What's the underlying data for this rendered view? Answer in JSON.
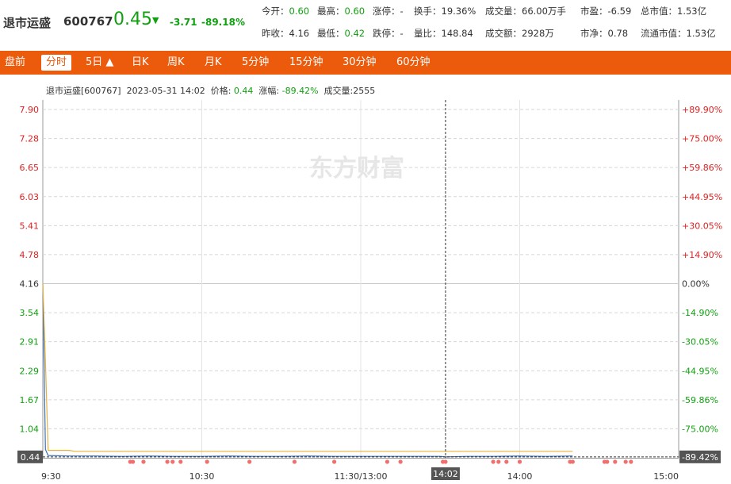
{
  "header": {
    "name": "退市运盛",
    "code": "600767",
    "price": "0.45",
    "arrow": "▼",
    "change": "-3.71",
    "change_pct": "-89.18%"
  },
  "quotes": [
    {
      "label": "今开：",
      "value": "0.60",
      "tone": "down"
    },
    {
      "label": "最高：",
      "value": "0.60",
      "tone": "down"
    },
    {
      "label": "涨停：",
      "value": "-",
      "tone": ""
    },
    {
      "label": "换手：",
      "value": "19.36%",
      "tone": ""
    },
    {
      "label": "成交量：",
      "value": "66.00万手",
      "tone": ""
    },
    {
      "label": "市盈：",
      "value": "-6.59",
      "tone": ""
    },
    {
      "label": "总市值：",
      "value": "1.53亿",
      "tone": ""
    },
    {
      "label": "昨收：",
      "value": "4.16",
      "tone": ""
    },
    {
      "label": "最低：",
      "value": "0.42",
      "tone": "down"
    },
    {
      "label": "跌停：",
      "value": "-",
      "tone": ""
    },
    {
      "label": "量比：",
      "value": "148.84",
      "tone": ""
    },
    {
      "label": "成交额：",
      "value": "2928万",
      "tone": ""
    },
    {
      "label": "市净：",
      "value": "0.78",
      "tone": ""
    },
    {
      "label": "流通市值：",
      "value": "1.53亿",
      "tone": ""
    }
  ],
  "tabs": [
    {
      "label": "盘前",
      "active": false
    },
    {
      "label": "分时",
      "active": true
    },
    {
      "label": "5日 ▲",
      "active": false
    },
    {
      "label": "日K",
      "active": false
    },
    {
      "label": "周K",
      "active": false
    },
    {
      "label": "月K",
      "active": false
    },
    {
      "label": "5分钟",
      "active": false
    },
    {
      "label": "15分钟",
      "active": false
    },
    {
      "label": "30分钟",
      "active": false
    },
    {
      "label": "60分钟",
      "active": false
    }
  ],
  "info": {
    "name_code": "退市运盛[600767]",
    "datetime": "2023-05-31 14:02",
    "price_label": "价格:",
    "price_value": "0.44",
    "change_label": "涨幅:",
    "change_value": "-89.42%",
    "volume_label": "成交量:",
    "volume_value": "2555"
  },
  "watermark": "东方财富",
  "chart_data": {
    "type": "line",
    "y_ticks_left": [
      "7.90",
      "7.28",
      "6.65",
      "6.03",
      "5.41",
      "4.78",
      "4.16",
      "3.54",
      "2.91",
      "2.29",
      "1.67",
      "1.04"
    ],
    "y_ticks_right": [
      "+89.90%",
      "+75.00%",
      "+59.86%",
      "+44.95%",
      "+30.05%",
      "+14.90%",
      "0.00%",
      "-14.90%",
      "-30.05%",
      "-44.95%",
      "-59.86%",
      "-75.00%"
    ],
    "ylim": [
      0.42,
      7.9
    ],
    "prev_close": 4.16,
    "x_ticks": [
      "9:30",
      "10:30",
      "11:30/13:00",
      "14:00",
      "15:00"
    ],
    "crosshair": {
      "time": "14:02",
      "price_label": "0.44",
      "pct_label": "-89.42%",
      "minute": 152
    },
    "total_minutes": 240,
    "series": [
      {
        "role": "price",
        "color": "#3b6fb5",
        "points": [
          [
            0,
            4.16
          ],
          [
            1,
            0.6
          ],
          [
            2,
            0.47
          ],
          [
            10,
            0.46
          ],
          [
            20,
            0.46
          ],
          [
            30,
            0.45
          ],
          [
            40,
            0.46
          ],
          [
            50,
            0.45
          ],
          [
            60,
            0.45
          ],
          [
            70,
            0.46
          ],
          [
            80,
            0.45
          ],
          [
            90,
            0.45
          ],
          [
            100,
            0.46
          ],
          [
            110,
            0.45
          ],
          [
            120,
            0.45
          ],
          [
            130,
            0.45
          ],
          [
            140,
            0.45
          ],
          [
            150,
            0.45
          ],
          [
            152,
            0.44
          ],
          [
            160,
            0.45
          ],
          [
            170,
            0.45
          ],
          [
            180,
            0.46
          ],
          [
            190,
            0.45
          ],
          [
            200,
            0.46
          ]
        ]
      },
      {
        "role": "average",
        "color": "#e8b23a",
        "points": [
          [
            0,
            4.16
          ],
          [
            1,
            2.5
          ],
          [
            2,
            0.58
          ],
          [
            10,
            0.58
          ],
          [
            12,
            0.56
          ],
          [
            30,
            0.56
          ],
          [
            60,
            0.56
          ],
          [
            120,
            0.56
          ],
          [
            180,
            0.56
          ],
          [
            200,
            0.56
          ]
        ]
      }
    ],
    "trade_markers": [
      33,
      34,
      38,
      47,
      49,
      52,
      62,
      78,
      95,
      110,
      130,
      135,
      151,
      152,
      170,
      172,
      175,
      180,
      199,
      200,
      212,
      213,
      216,
      220,
      222
    ]
  }
}
